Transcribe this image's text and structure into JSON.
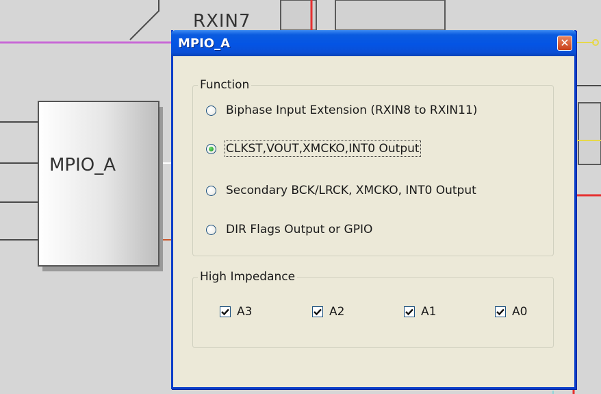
{
  "background": {
    "partial_label": "RXIN7",
    "block_label": "MPIO_A"
  },
  "dialog": {
    "title": "MPIO_A",
    "close_glyph": "✕",
    "function_group": {
      "legend": "Function",
      "options": [
        {
          "label": "Biphase Input Extension (RXIN8 to RXIN11)",
          "checked": false
        },
        {
          "label": "CLKST,VOUT,XMCKO,INT0 Output",
          "checked": true
        },
        {
          "label": "Secondary BCK/LRCK, XMCKO, INT0 Output",
          "checked": false
        },
        {
          "label": "DIR Flags Output or GPIO",
          "checked": false
        }
      ]
    },
    "high_impedance_group": {
      "legend": "High Impedance",
      "checkboxes": [
        {
          "label": "A3",
          "checked": true
        },
        {
          "label": "A2",
          "checked": true
        },
        {
          "label": "A1",
          "checked": true
        },
        {
          "label": "A0",
          "checked": true
        }
      ]
    }
  },
  "colors": {
    "titlebar": "#0454e4",
    "dialog_bg": "#ece9d8",
    "wire_red": "#e53030",
    "wire_magenta": "#c86ad6",
    "wire_yellow": "#e6d84a",
    "wire_cyan": "#8fd6d9",
    "wire_orange": "#c8562a"
  }
}
